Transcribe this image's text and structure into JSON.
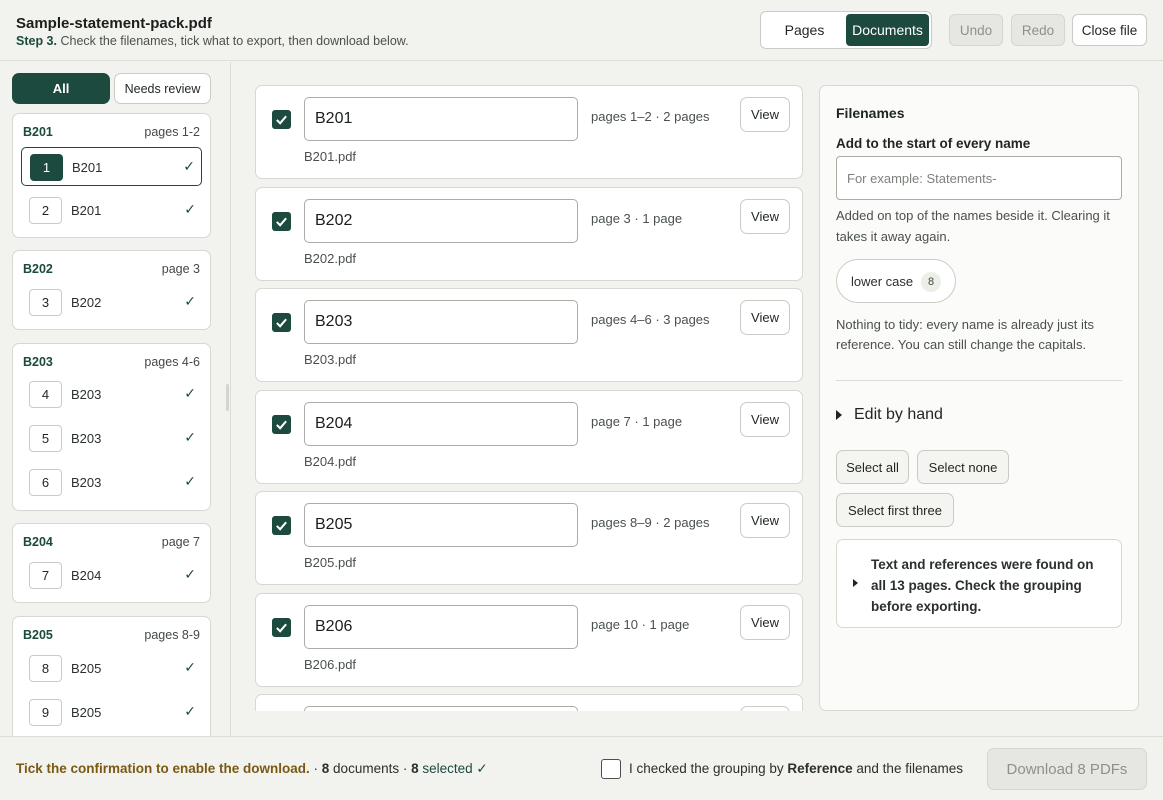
{
  "header": {
    "file_title": "Sample-statement-pack.pdf",
    "step_label": "Step 3.",
    "step_text": "Check the filenames, tick what to export, then download below.",
    "view_tabs": [
      "Pages",
      "Documents"
    ],
    "active_view": "Documents",
    "undo_label": "Undo",
    "redo_label": "Redo",
    "close_label": "Close file"
  },
  "sidebar": {
    "filters": {
      "all": "All",
      "needs_review": "Needs review"
    },
    "groups": [
      {
        "ref": "B201",
        "range": "pages 1-2",
        "pages": [
          {
            "num": "1",
            "label": "B201",
            "check": "✓"
          },
          {
            "num": "2",
            "label": "B201",
            "check": "✓"
          }
        ]
      },
      {
        "ref": "B202",
        "range": "page 3",
        "pages": [
          {
            "num": "3",
            "label": "B202",
            "check": "✓"
          }
        ]
      },
      {
        "ref": "B203",
        "range": "pages 4-6",
        "pages": [
          {
            "num": "4",
            "label": "B203",
            "check": "✓"
          },
          {
            "num": "5",
            "label": "B203",
            "check": "✓"
          },
          {
            "num": "6",
            "label": "B203",
            "check": "✓"
          }
        ]
      },
      {
        "ref": "B204",
        "range": "page 7",
        "pages": [
          {
            "num": "7",
            "label": "B204",
            "check": "✓"
          }
        ]
      },
      {
        "ref": "B205",
        "range": "pages 8-9",
        "pages": [
          {
            "num": "8",
            "label": "B205",
            "check": "✓"
          },
          {
            "num": "9",
            "label": "B205",
            "check": "✓"
          }
        ]
      }
    ]
  },
  "documents": [
    {
      "name": "B201",
      "pages": "pages 1–2 · 2 pages",
      "file": "B201.pdf",
      "view": "View",
      "checked": true
    },
    {
      "name": "B202",
      "pages": "page 3 · 1 page",
      "file": "B202.pdf",
      "view": "View",
      "checked": true
    },
    {
      "name": "B203",
      "pages": "pages 4–6 · 3 pages",
      "file": "B203.pdf",
      "view": "View",
      "checked": true
    },
    {
      "name": "B204",
      "pages": "page 7 · 1 page",
      "file": "B204.pdf",
      "view": "View",
      "checked": true
    },
    {
      "name": "B205",
      "pages": "pages 8–9 · 2 pages",
      "file": "B205.pdf",
      "view": "View",
      "checked": true
    },
    {
      "name": "B206",
      "pages": "page 10 · 1 page",
      "file": "B206.pdf",
      "view": "View",
      "checked": true
    }
  ],
  "filenames_panel": {
    "title": "Filenames",
    "prefix_label": "Add to the start of every name",
    "prefix_placeholder": "For example: Statements-",
    "prefix_value": "",
    "prefix_help": "Added on top of the names beside it. Clearing it takes it away again.",
    "lowercase_label": "lower case",
    "lowercase_count": "8",
    "tidy_note": "Nothing to tidy: every name is already just its reference. You can still change the capitals.",
    "edit_by_hand": "Edit by hand",
    "select_all": "Select all",
    "select_none": "Select none",
    "select_first_three": "Select first three",
    "info_text": "Text and references were found on all 13 pages. Check the grouping before exporting."
  },
  "footer": {
    "warning": "Tick the confirmation to enable the download.",
    "sep1": " · ",
    "doc_count": "8",
    "doc_word": " documents · ",
    "selected_count": "8",
    "selected_word": " selected ✓",
    "confirm_pre": "I checked the grouping by ",
    "confirm_bold": "Reference",
    "confirm_post": " and the filenames",
    "download_label": "Download 8 PDFs"
  },
  "colors": {
    "accent": "#1c4a3e",
    "warning": "#7a5a13"
  }
}
